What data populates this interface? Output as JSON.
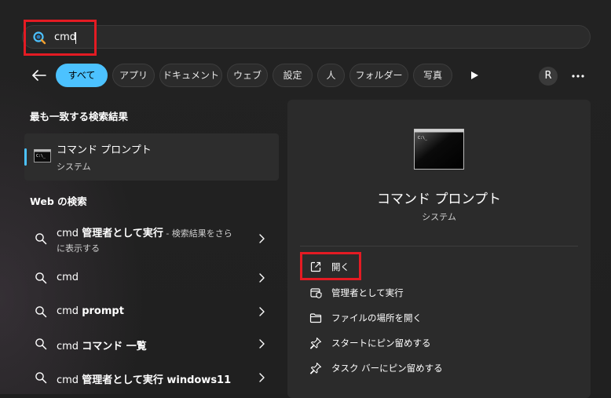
{
  "search": {
    "query": "cmd"
  },
  "filters": {
    "chips": [
      "すべて",
      "アプリ",
      "ドキュメント",
      "ウェブ",
      "設定",
      "人",
      "フォルダー",
      "写真"
    ],
    "active": "すべて",
    "avatar_initial": "R"
  },
  "best_match": {
    "heading": "最も一致する検索結果",
    "title": "コマンド プロンプト",
    "subtitle": "システム"
  },
  "web": {
    "heading": "Web の検索",
    "items": [
      {
        "query": "cmd",
        "bold": "管理者として実行",
        "suffix": " - 検索結果をさら",
        "line2": "に表示する"
      },
      {
        "query": "cmd",
        "bold": ""
      },
      {
        "query": "cmd",
        "bold": "prompt"
      },
      {
        "query": "cmd",
        "bold": "コマンド 一覧"
      },
      {
        "query": "cmd",
        "bold": "管理者として実行 windows11"
      }
    ]
  },
  "detail": {
    "title": "コマンド プロンプト",
    "subtitle": "システム",
    "actions": [
      {
        "label": "開く",
        "icon": "open-external-icon"
      },
      {
        "label": "管理者として実行",
        "icon": "shield-run-admin-icon"
      },
      {
        "label": "ファイルの場所を開く",
        "icon": "folder-icon"
      },
      {
        "label": "スタートにピン留めする",
        "icon": "pin-icon"
      },
      {
        "label": "タスク バーにピン留めする",
        "icon": "pin-icon"
      }
    ]
  },
  "colors": {
    "accent": "#4cc2ff",
    "highlight_box": "#e41b23",
    "background": "#202020",
    "panel": "#2b2b2b"
  }
}
